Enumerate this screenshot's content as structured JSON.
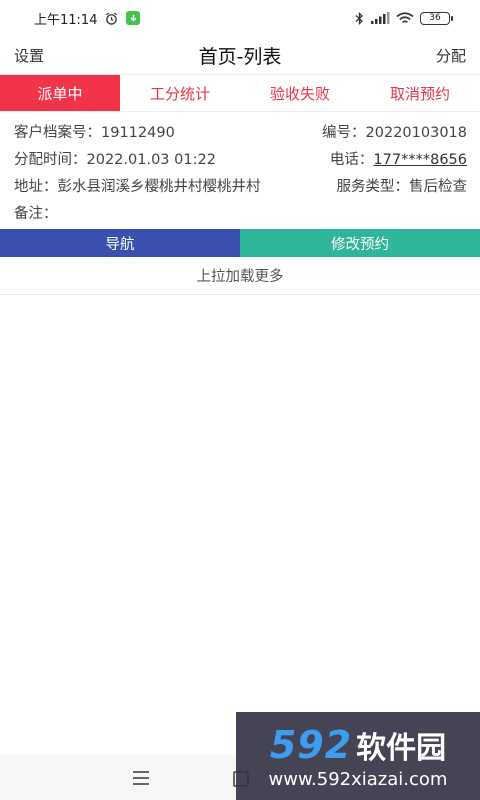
{
  "status_bar": {
    "time": "上午11:14",
    "battery": "36"
  },
  "header": {
    "left": "设置",
    "title": "首页-列表",
    "right": "分配"
  },
  "tabs": [
    {
      "label": "派单中",
      "active": true
    },
    {
      "label": "工分统计",
      "active": false
    },
    {
      "label": "验收失败",
      "active": false
    },
    {
      "label": "取消预约",
      "active": false
    }
  ],
  "order": {
    "customer_no_label": "客户档案号：",
    "customer_no": "19112490",
    "number_label": "编号：",
    "number": "20220103018",
    "assign_time_label": "分配时间：",
    "assign_time": "2022.01.03 01:22",
    "phone_label": "电话：",
    "phone": "177****8656",
    "address_label": "地址：",
    "address": "彭水县润溪乡樱桃井村樱桃井村",
    "service_type_label": "服务类型：",
    "service_type": "售后检查",
    "remark_label": "备注："
  },
  "actions": {
    "navigate": "导航",
    "modify": "修改预约"
  },
  "load_more": "上拉加载更多",
  "watermark": {
    "number": "592",
    "name": "软件园",
    "url": "www.592xiazai.com"
  },
  "colors": {
    "tab_active_bg": "#f1344a",
    "tab_text": "#e8334c",
    "navigate_btn": "#3a4fae",
    "modify_btn": "#2fb59a"
  }
}
